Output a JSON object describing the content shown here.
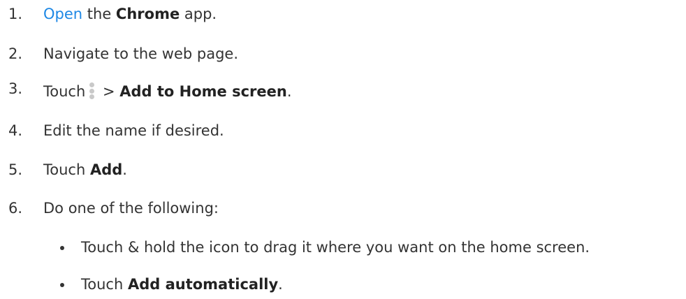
{
  "steps": [
    {
      "number": "1.",
      "link": "Open",
      "text_a": " the ",
      "bold": "Chrome",
      "text_b": " app."
    },
    {
      "number": "2.",
      "text": "Navigate to the web page."
    },
    {
      "number": "3.",
      "text_a": "Touch",
      "icon": "more-vert-icon",
      "text_b": " > ",
      "bold": "Add to Home screen",
      "text_c": "."
    },
    {
      "number": "4.",
      "text": "Edit the name if desired."
    },
    {
      "number": "5.",
      "text_a": "Touch ",
      "bold": "Add",
      "text_b": "."
    },
    {
      "number": "6.",
      "text": "Do one of the following:"
    }
  ],
  "bullets": [
    {
      "text": "Touch & hold the icon to drag it where you want on the home screen."
    },
    {
      "text_a": "Touch ",
      "bold": "Add automatically",
      "text_b": "."
    }
  ],
  "colors": {
    "link": "#1e88e5",
    "text": "#333333",
    "icon": "#c9c9c9"
  }
}
